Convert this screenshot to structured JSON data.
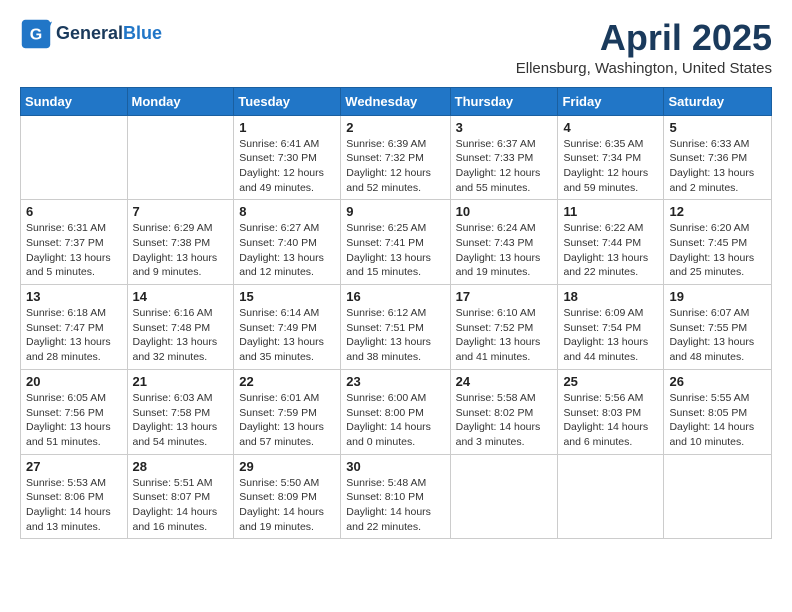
{
  "header": {
    "logo_line1": "General",
    "logo_line2": "Blue",
    "month": "April 2025",
    "location": "Ellensburg, Washington, United States"
  },
  "days_of_week": [
    "Sunday",
    "Monday",
    "Tuesday",
    "Wednesday",
    "Thursday",
    "Friday",
    "Saturday"
  ],
  "weeks": [
    [
      {
        "day": "",
        "info": ""
      },
      {
        "day": "",
        "info": ""
      },
      {
        "day": "1",
        "info": "Sunrise: 6:41 AM\nSunset: 7:30 PM\nDaylight: 12 hours and 49 minutes."
      },
      {
        "day": "2",
        "info": "Sunrise: 6:39 AM\nSunset: 7:32 PM\nDaylight: 12 hours and 52 minutes."
      },
      {
        "day": "3",
        "info": "Sunrise: 6:37 AM\nSunset: 7:33 PM\nDaylight: 12 hours and 55 minutes."
      },
      {
        "day": "4",
        "info": "Sunrise: 6:35 AM\nSunset: 7:34 PM\nDaylight: 12 hours and 59 minutes."
      },
      {
        "day": "5",
        "info": "Sunrise: 6:33 AM\nSunset: 7:36 PM\nDaylight: 13 hours and 2 minutes."
      }
    ],
    [
      {
        "day": "6",
        "info": "Sunrise: 6:31 AM\nSunset: 7:37 PM\nDaylight: 13 hours and 5 minutes."
      },
      {
        "day": "7",
        "info": "Sunrise: 6:29 AM\nSunset: 7:38 PM\nDaylight: 13 hours and 9 minutes."
      },
      {
        "day": "8",
        "info": "Sunrise: 6:27 AM\nSunset: 7:40 PM\nDaylight: 13 hours and 12 minutes."
      },
      {
        "day": "9",
        "info": "Sunrise: 6:25 AM\nSunset: 7:41 PM\nDaylight: 13 hours and 15 minutes."
      },
      {
        "day": "10",
        "info": "Sunrise: 6:24 AM\nSunset: 7:43 PM\nDaylight: 13 hours and 19 minutes."
      },
      {
        "day": "11",
        "info": "Sunrise: 6:22 AM\nSunset: 7:44 PM\nDaylight: 13 hours and 22 minutes."
      },
      {
        "day": "12",
        "info": "Sunrise: 6:20 AM\nSunset: 7:45 PM\nDaylight: 13 hours and 25 minutes."
      }
    ],
    [
      {
        "day": "13",
        "info": "Sunrise: 6:18 AM\nSunset: 7:47 PM\nDaylight: 13 hours and 28 minutes."
      },
      {
        "day": "14",
        "info": "Sunrise: 6:16 AM\nSunset: 7:48 PM\nDaylight: 13 hours and 32 minutes."
      },
      {
        "day": "15",
        "info": "Sunrise: 6:14 AM\nSunset: 7:49 PM\nDaylight: 13 hours and 35 minutes."
      },
      {
        "day": "16",
        "info": "Sunrise: 6:12 AM\nSunset: 7:51 PM\nDaylight: 13 hours and 38 minutes."
      },
      {
        "day": "17",
        "info": "Sunrise: 6:10 AM\nSunset: 7:52 PM\nDaylight: 13 hours and 41 minutes."
      },
      {
        "day": "18",
        "info": "Sunrise: 6:09 AM\nSunset: 7:54 PM\nDaylight: 13 hours and 44 minutes."
      },
      {
        "day": "19",
        "info": "Sunrise: 6:07 AM\nSunset: 7:55 PM\nDaylight: 13 hours and 48 minutes."
      }
    ],
    [
      {
        "day": "20",
        "info": "Sunrise: 6:05 AM\nSunset: 7:56 PM\nDaylight: 13 hours and 51 minutes."
      },
      {
        "day": "21",
        "info": "Sunrise: 6:03 AM\nSunset: 7:58 PM\nDaylight: 13 hours and 54 minutes."
      },
      {
        "day": "22",
        "info": "Sunrise: 6:01 AM\nSunset: 7:59 PM\nDaylight: 13 hours and 57 minutes."
      },
      {
        "day": "23",
        "info": "Sunrise: 6:00 AM\nSunset: 8:00 PM\nDaylight: 14 hours and 0 minutes."
      },
      {
        "day": "24",
        "info": "Sunrise: 5:58 AM\nSunset: 8:02 PM\nDaylight: 14 hours and 3 minutes."
      },
      {
        "day": "25",
        "info": "Sunrise: 5:56 AM\nSunset: 8:03 PM\nDaylight: 14 hours and 6 minutes."
      },
      {
        "day": "26",
        "info": "Sunrise: 5:55 AM\nSunset: 8:05 PM\nDaylight: 14 hours and 10 minutes."
      }
    ],
    [
      {
        "day": "27",
        "info": "Sunrise: 5:53 AM\nSunset: 8:06 PM\nDaylight: 14 hours and 13 minutes."
      },
      {
        "day": "28",
        "info": "Sunrise: 5:51 AM\nSunset: 8:07 PM\nDaylight: 14 hours and 16 minutes."
      },
      {
        "day": "29",
        "info": "Sunrise: 5:50 AM\nSunset: 8:09 PM\nDaylight: 14 hours and 19 minutes."
      },
      {
        "day": "30",
        "info": "Sunrise: 5:48 AM\nSunset: 8:10 PM\nDaylight: 14 hours and 22 minutes."
      },
      {
        "day": "",
        "info": ""
      },
      {
        "day": "",
        "info": ""
      },
      {
        "day": "",
        "info": ""
      }
    ]
  ]
}
